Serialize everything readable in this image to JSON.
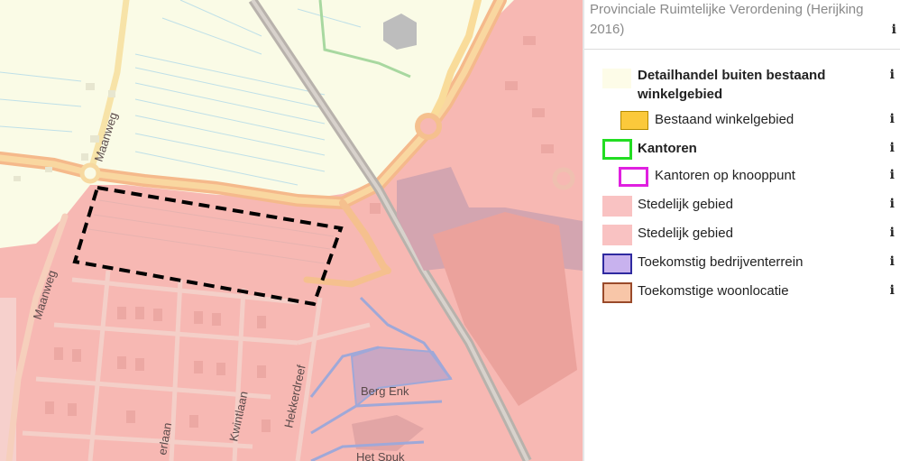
{
  "map": {
    "labels": {
      "maanweg_top": "Maanweg",
      "maanweg_left": "Maanweg",
      "berg_enk": "Berg Enk",
      "hekkerdreef": "Hekkerdreef",
      "kwintlaan": "Kwintlaan",
      "erlaan": "erlaan",
      "het_spuk": "Het Spuk"
    }
  },
  "legend": {
    "title": "Provinciale Ruimtelijke Verordening (Herijking 2016)",
    "info_glyph": "i",
    "items": [
      {
        "label": "Detailhandel buiten bestaand winkelgebied",
        "swatch": "fill #fdfce8"
      },
      {
        "label": "Bestaand winkelgebied",
        "swatch": "fill #fbc93b, border #b38a00"
      },
      {
        "label": "Kantoren",
        "swatch": "border #22dd22"
      },
      {
        "label": "Kantoren op knooppunt",
        "swatch": "border #e020e0"
      },
      {
        "label": "Stedelijk gebied",
        "swatch": "fill #f9c2c2"
      },
      {
        "label": "Stedelijk gebied",
        "swatch": "fill #f9c2c2"
      },
      {
        "label": "Toekomstig bedrijventerrein",
        "swatch": "fill #c8b2ee, border #2f2aa0"
      },
      {
        "label": "Toekomstige woonlocatie",
        "swatch": "fill #f8c6a8, border #9a4a2a"
      }
    ]
  }
}
